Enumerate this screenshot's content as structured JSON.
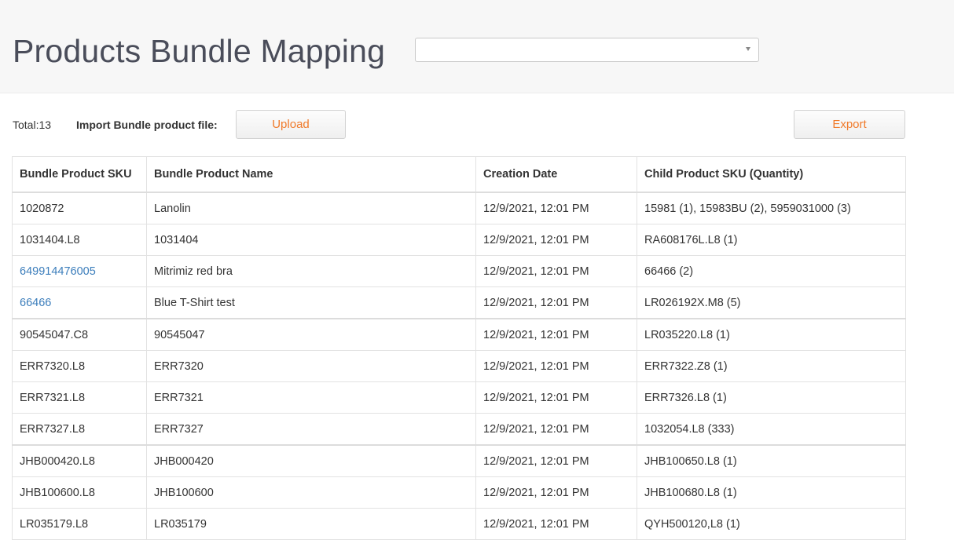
{
  "header": {
    "title": "Products Bundle Mapping",
    "select": {
      "value": ""
    }
  },
  "toolbar": {
    "total": "Total:13",
    "import_label": "Import Bundle product file:",
    "upload_label": "Upload",
    "export_label": "Export"
  },
  "table": {
    "columns": [
      "Bundle Product SKU",
      "Bundle Product Name",
      "Creation Date",
      "Child Product SKU (Quantity)"
    ],
    "rows": [
      {
        "sku": "1020872",
        "name": "Lanolin",
        "date": "12/9/2021, 12:01 PM",
        "children": "15981 (1), 15983BU (2), 5959031000 (3)"
      },
      {
        "sku": "1031404.L8",
        "name": "1031404",
        "date": "12/9/2021, 12:01 PM",
        "children": "RA608176L.L8 (1)"
      },
      {
        "sku": "649914476005",
        "name": "Mitrimiz red bra",
        "date": "12/9/2021, 12:01 PM",
        "children": "66466 (2)"
      },
      {
        "sku": "66466",
        "name": "Blue T-Shirt test",
        "date": "12/9/2021, 12:01 PM",
        "children": "LR026192X.M8 (5)"
      },
      {
        "sku": "90545047.C8",
        "name": "90545047",
        "date": "12/9/2021, 12:01 PM",
        "children": "LR035220.L8 (1)"
      },
      {
        "sku": "ERR7320.L8",
        "name": "ERR7320",
        "date": "12/9/2021, 12:01 PM",
        "children": "ERR7322.Z8 (1)"
      },
      {
        "sku": "ERR7321.L8",
        "name": "ERR7321",
        "date": "12/9/2021, 12:01 PM",
        "children": "ERR7326.L8 (1)"
      },
      {
        "sku": "ERR7327.L8",
        "name": "ERR7327",
        "date": "12/9/2021, 12:01 PM",
        "children": "1032054.L8 (333)"
      },
      {
        "sku": "JHB000420.L8",
        "name": "JHB000420",
        "date": "12/9/2021, 12:01 PM",
        "children": "JHB100650.L8 (1)"
      },
      {
        "sku": "JHB100600.L8",
        "name": "JHB100600",
        "date": "12/9/2021, 12:01 PM",
        "children": "JHB100680.L8 (1)"
      },
      {
        "sku": "LR035179.L8",
        "name": "LR035179",
        "date": "12/9/2021, 12:01 PM",
        "children": "QYH500120,L8 (1)"
      }
    ]
  },
  "colors": {
    "accent": "#f07a2a",
    "link": "#3b7dbb",
    "header_bg": "#f7f7f7"
  }
}
